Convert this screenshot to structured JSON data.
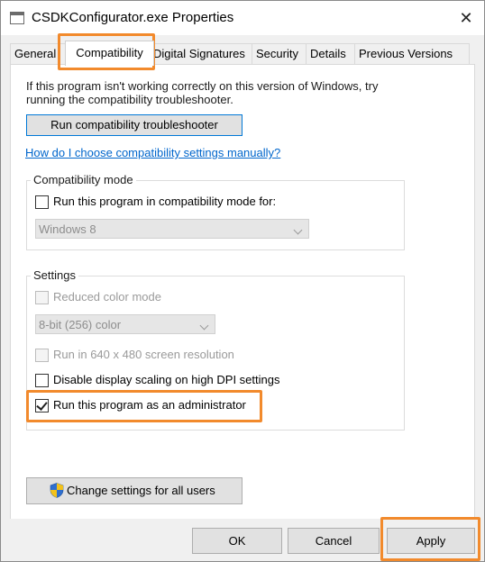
{
  "window": {
    "title": "CSDKConfigurator.exe Properties",
    "close_glyph": "✕"
  },
  "tabs": [
    {
      "label": "General"
    },
    {
      "label": "Compatibility"
    },
    {
      "label": "Digital Signatures"
    },
    {
      "label": "Security"
    },
    {
      "label": "Details"
    },
    {
      "label": "Previous Versions"
    }
  ],
  "compat": {
    "intro": "If this program isn't working correctly on this version of Windows, try running the compatibility troubleshooter.",
    "troubleshooter_button": "Run compatibility troubleshooter",
    "help_link": "How do I choose compatibility settings manually?"
  },
  "compat_mode": {
    "group_title": "Compatibility mode",
    "checkbox_label": "Run this program in compatibility mode for:",
    "checked": false,
    "os_select_value": "Windows 8"
  },
  "settings": {
    "group_title": "Settings",
    "reduced_color_label": "Reduced color mode",
    "color_select_value": "8-bit (256) color",
    "resolution_label": "Run in 640 x 480 screen resolution",
    "dpi_label": "Disable display scaling on high DPI settings",
    "admin_label": "Run this program as an administrator",
    "admin_checked": true
  },
  "change_all_button": "Change settings for all users",
  "dialog_buttons": {
    "ok": "OK",
    "cancel": "Cancel",
    "apply": "Apply"
  },
  "colors": {
    "highlight": "#f28a2c",
    "link": "#0066cc",
    "focus_border": "#0078d7"
  },
  "icons": {
    "window": "app-window-icon",
    "close": "close-icon",
    "shield": "uac-shield-icon",
    "dropdown": "chevron-down-icon"
  }
}
